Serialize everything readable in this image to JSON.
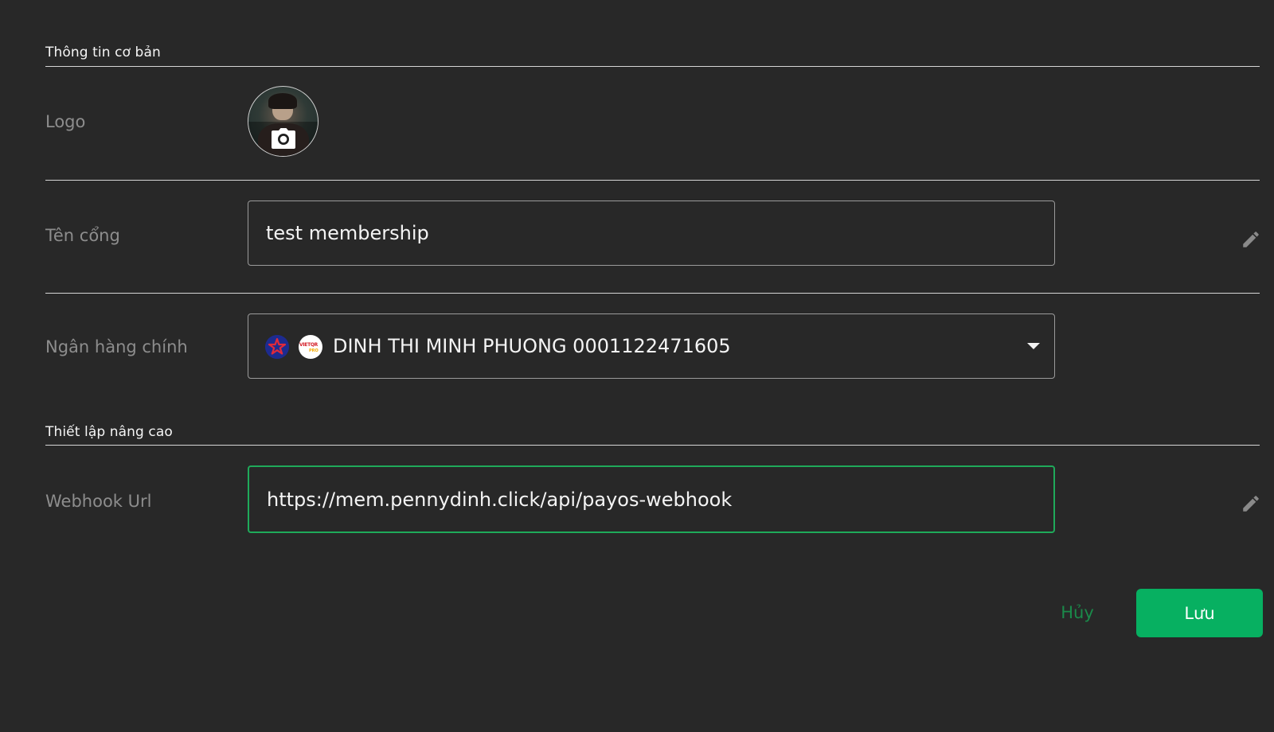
{
  "sections": {
    "basic_info": "Thông tin cơ bản",
    "advanced": "Thiết lập nâng cao"
  },
  "logo": {
    "label": "Logo",
    "icon": "camera-icon"
  },
  "gateway_name": {
    "label": "Tên cổng",
    "value": "test membership",
    "edit_icon": "pencil-icon"
  },
  "main_bank": {
    "label": "Ngân hàng chính",
    "value": "DINH THI MINH PHUONG 0001122471605",
    "bank_logo_1": "star-bank-logo",
    "bank_logo_2": {
      "name": "vietqr-logo",
      "text": "VIETQR",
      "sub": "PRO"
    },
    "dropdown_icon": "caret-down-icon"
  },
  "webhook": {
    "label": "Webhook Url",
    "value": "https://mem.pennydinh.click/api/payos-webhook",
    "edit_icon": "pencil-icon"
  },
  "actions": {
    "cancel_label": "Hủy",
    "save_label": "Lưu"
  },
  "colors": {
    "background": "#282828",
    "accent_green": "#07b061",
    "focus_border": "#1faa5a",
    "label_gray": "#8d8d8d"
  }
}
